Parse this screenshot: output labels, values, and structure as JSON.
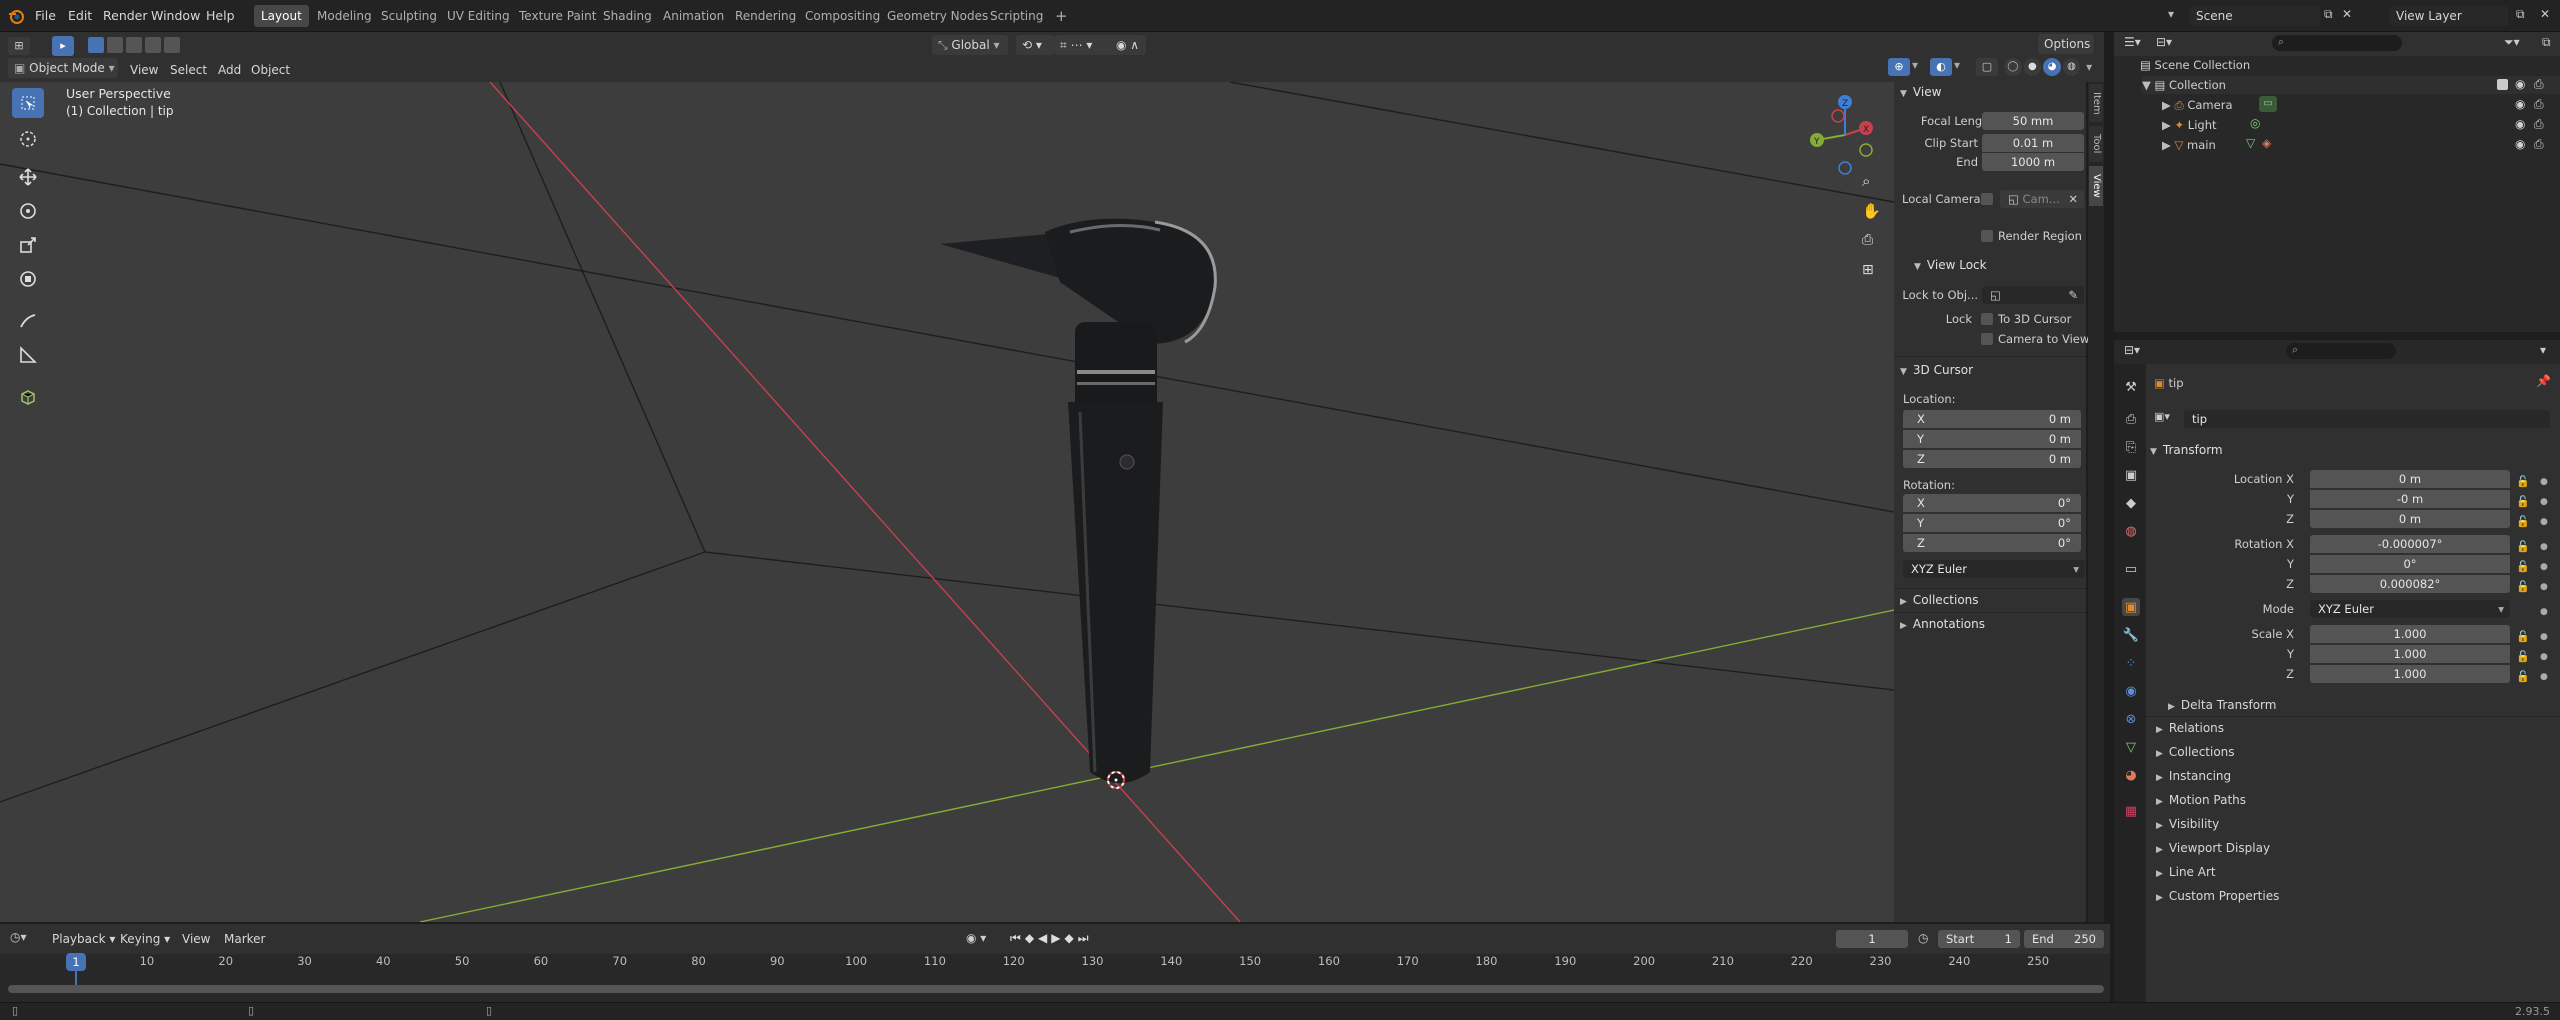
{
  "menu": [
    "File",
    "Edit",
    "Render",
    "Window",
    "Help"
  ],
  "workspaces": [
    "Layout",
    "Modeling",
    "Sculpting",
    "UV Editing",
    "Texture Paint",
    "Shading",
    "Animation",
    "Rendering",
    "Compositing",
    "Geometry Nodes",
    "Scripting"
  ],
  "scene": {
    "name": "Scene",
    "view_layer": "View Layer"
  },
  "viewport_header": {
    "mode": "Object Mode",
    "menus": [
      "View",
      "Select",
      "Add",
      "Object"
    ],
    "orientation": "Global",
    "options": "Options"
  },
  "viewport": {
    "title": "User Perspective",
    "subtitle": "(1) Collection | tip",
    "gizmo_axes": [
      "X",
      "Y",
      "Z"
    ]
  },
  "npanel": {
    "tabs": [
      "Item",
      "Tool",
      "View"
    ],
    "view_header": "View",
    "focal_length_label": "Focal Length",
    "focal_length": "50 mm",
    "clip_start_label": "Clip Start",
    "clip_start": "0.01 m",
    "end_label": "End",
    "end": "1000 m",
    "local_camera_label": "Local Camera",
    "local_camera_value": "Cam...",
    "render_region": "Render Region",
    "view_lock_header": "View Lock",
    "lock_to_obj": "Lock to Obj...",
    "lock_label": "Lock",
    "to_3d_cursor": "To 3D Cursor",
    "camera_to_view": "Camera to View",
    "cursor_header": "3D Cursor",
    "location_label": "Location:",
    "loc": [
      {
        "axis": "X",
        "val": "0 m"
      },
      {
        "axis": "Y",
        "val": "0 m"
      },
      {
        "axis": "Z",
        "val": "0 m"
      }
    ],
    "rotation_label": "Rotation:",
    "rot": [
      {
        "axis": "X",
        "val": "0°"
      },
      {
        "axis": "Y",
        "val": "0°"
      },
      {
        "axis": "Z",
        "val": "0°"
      }
    ],
    "rotation_mode": "XYZ Euler",
    "collections": "Collections",
    "annotations": "Annotations"
  },
  "outliner": {
    "root": "Scene Collection",
    "collection": "Collection",
    "items": [
      "Camera",
      "Light",
      "main"
    ]
  },
  "properties": {
    "object_name": "tip",
    "datablock": "tip",
    "transform_header": "Transform",
    "location_x_label": "Location X",
    "y_label": "Y",
    "z_label": "Z",
    "location": [
      "0 m",
      "-0 m",
      "0 m"
    ],
    "rotation_x_label": "Rotation X",
    "rotation": [
      "-0.000007°",
      "0°",
      "0.000082°"
    ],
    "mode_label": "Mode",
    "mode": "XYZ Euler",
    "scale_x_label": "Scale X",
    "scale": [
      "1.000",
      "1.000",
      "1.000"
    ],
    "delta_transform": "Delta Transform",
    "sections": [
      "Relations",
      "Collections",
      "Instancing",
      "Motion Paths",
      "Visibility",
      "Viewport Display",
      "Line Art",
      "Custom Properties"
    ]
  },
  "timeline": {
    "menus": [
      "Playback",
      "Keying",
      "View",
      "Marker"
    ],
    "current_frame": "1",
    "start_label": "Start",
    "start": "1",
    "end_label": "End",
    "end": "250",
    "ticks": [
      "10",
      "20",
      "30",
      "40",
      "50",
      "60",
      "70",
      "80",
      "90",
      "100",
      "110",
      "120",
      "130",
      "140",
      "150",
      "160",
      "170",
      "180",
      "190",
      "200",
      "210",
      "220",
      "230",
      "240",
      "250"
    ]
  },
  "status": {
    "version": "2.93.5"
  },
  "colors": {
    "accent": "#4772b3",
    "x_axis": "#c8404e",
    "y_axis": "#83ad33",
    "z_axis": "#3f7fd8",
    "object_orange": "#e08a2e"
  }
}
